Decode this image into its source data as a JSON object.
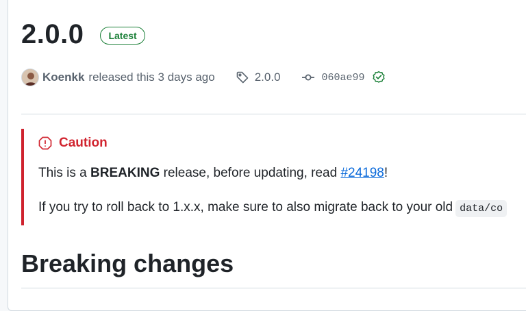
{
  "release": {
    "version": "2.0.0",
    "badge": "Latest",
    "author": "Koenkk",
    "released_text": "released this 3 days ago",
    "tag": "2.0.0",
    "commit": "060ae99"
  },
  "alert": {
    "title": "Caution",
    "line1_prefix": "This is a ",
    "line1_bold": "BREAKING",
    "line1_middle": " release, before updating, read ",
    "line1_link": "#24198",
    "line1_suffix": "!",
    "line2_text": "If you try to roll back to 1.x.x, make sure to also migrate back to your old",
    "line2_code": "data/co"
  },
  "section": {
    "heading": "Breaking changes"
  },
  "colors": {
    "latest_green": "#1a7f37",
    "caution_red": "#cf222e",
    "link_blue": "#0969da"
  },
  "icons": [
    "tag-icon",
    "git-commit-icon",
    "verified-icon",
    "stop-icon"
  ]
}
